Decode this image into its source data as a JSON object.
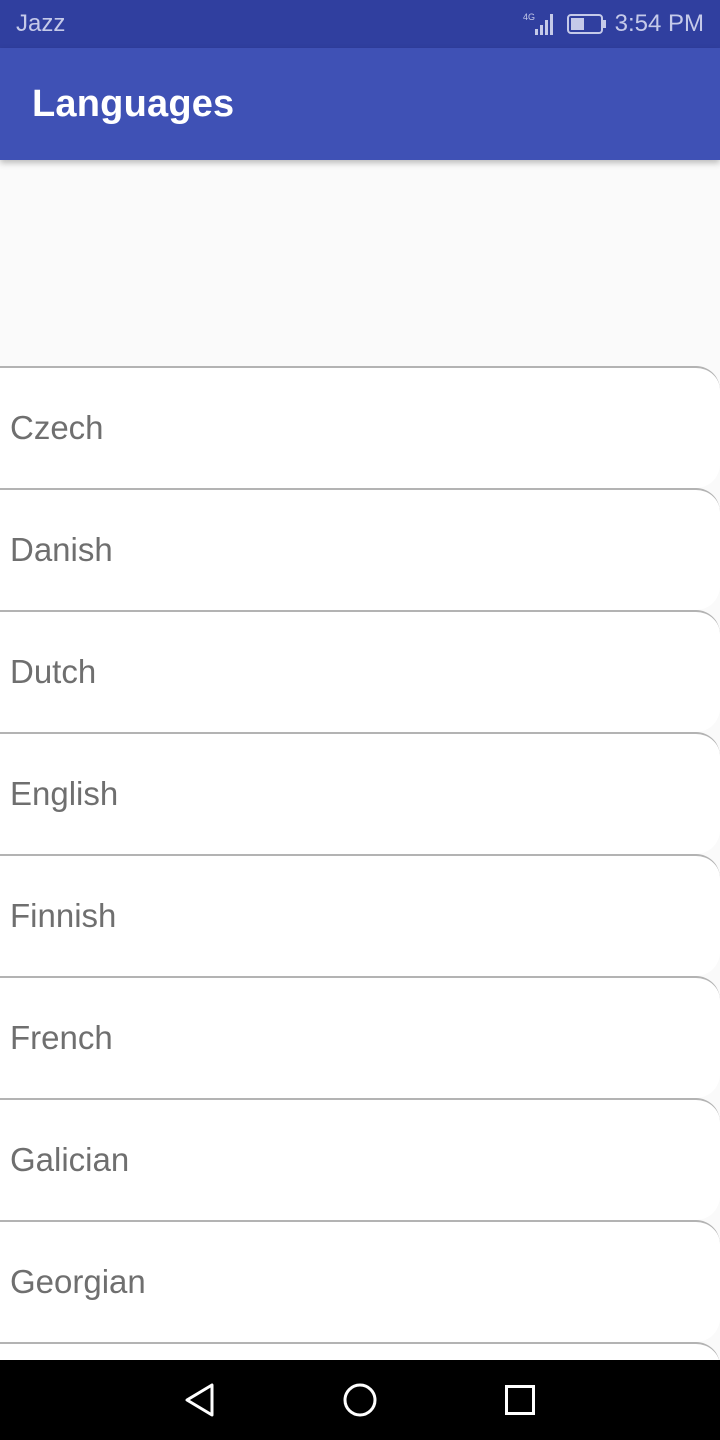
{
  "status_bar": {
    "carrier": "Jazz",
    "network_type": "4G",
    "time": "3:54 PM",
    "icons": [
      "signal-icon",
      "battery-icon"
    ]
  },
  "app_bar": {
    "title": "Languages"
  },
  "languages": [
    {
      "label": "Czech"
    },
    {
      "label": "Danish"
    },
    {
      "label": "Dutch"
    },
    {
      "label": "English"
    },
    {
      "label": "Finnish"
    },
    {
      "label": "French"
    },
    {
      "label": "Galician"
    },
    {
      "label": "Georgian"
    }
  ],
  "nav_bar": {
    "icons": [
      "back-icon",
      "home-icon",
      "recents-icon"
    ]
  },
  "colors": {
    "status_bar": "#303f9f",
    "app_bar": "#3f51b5",
    "list_text": "#6f6f6f",
    "divider": "#b3b3b3"
  }
}
